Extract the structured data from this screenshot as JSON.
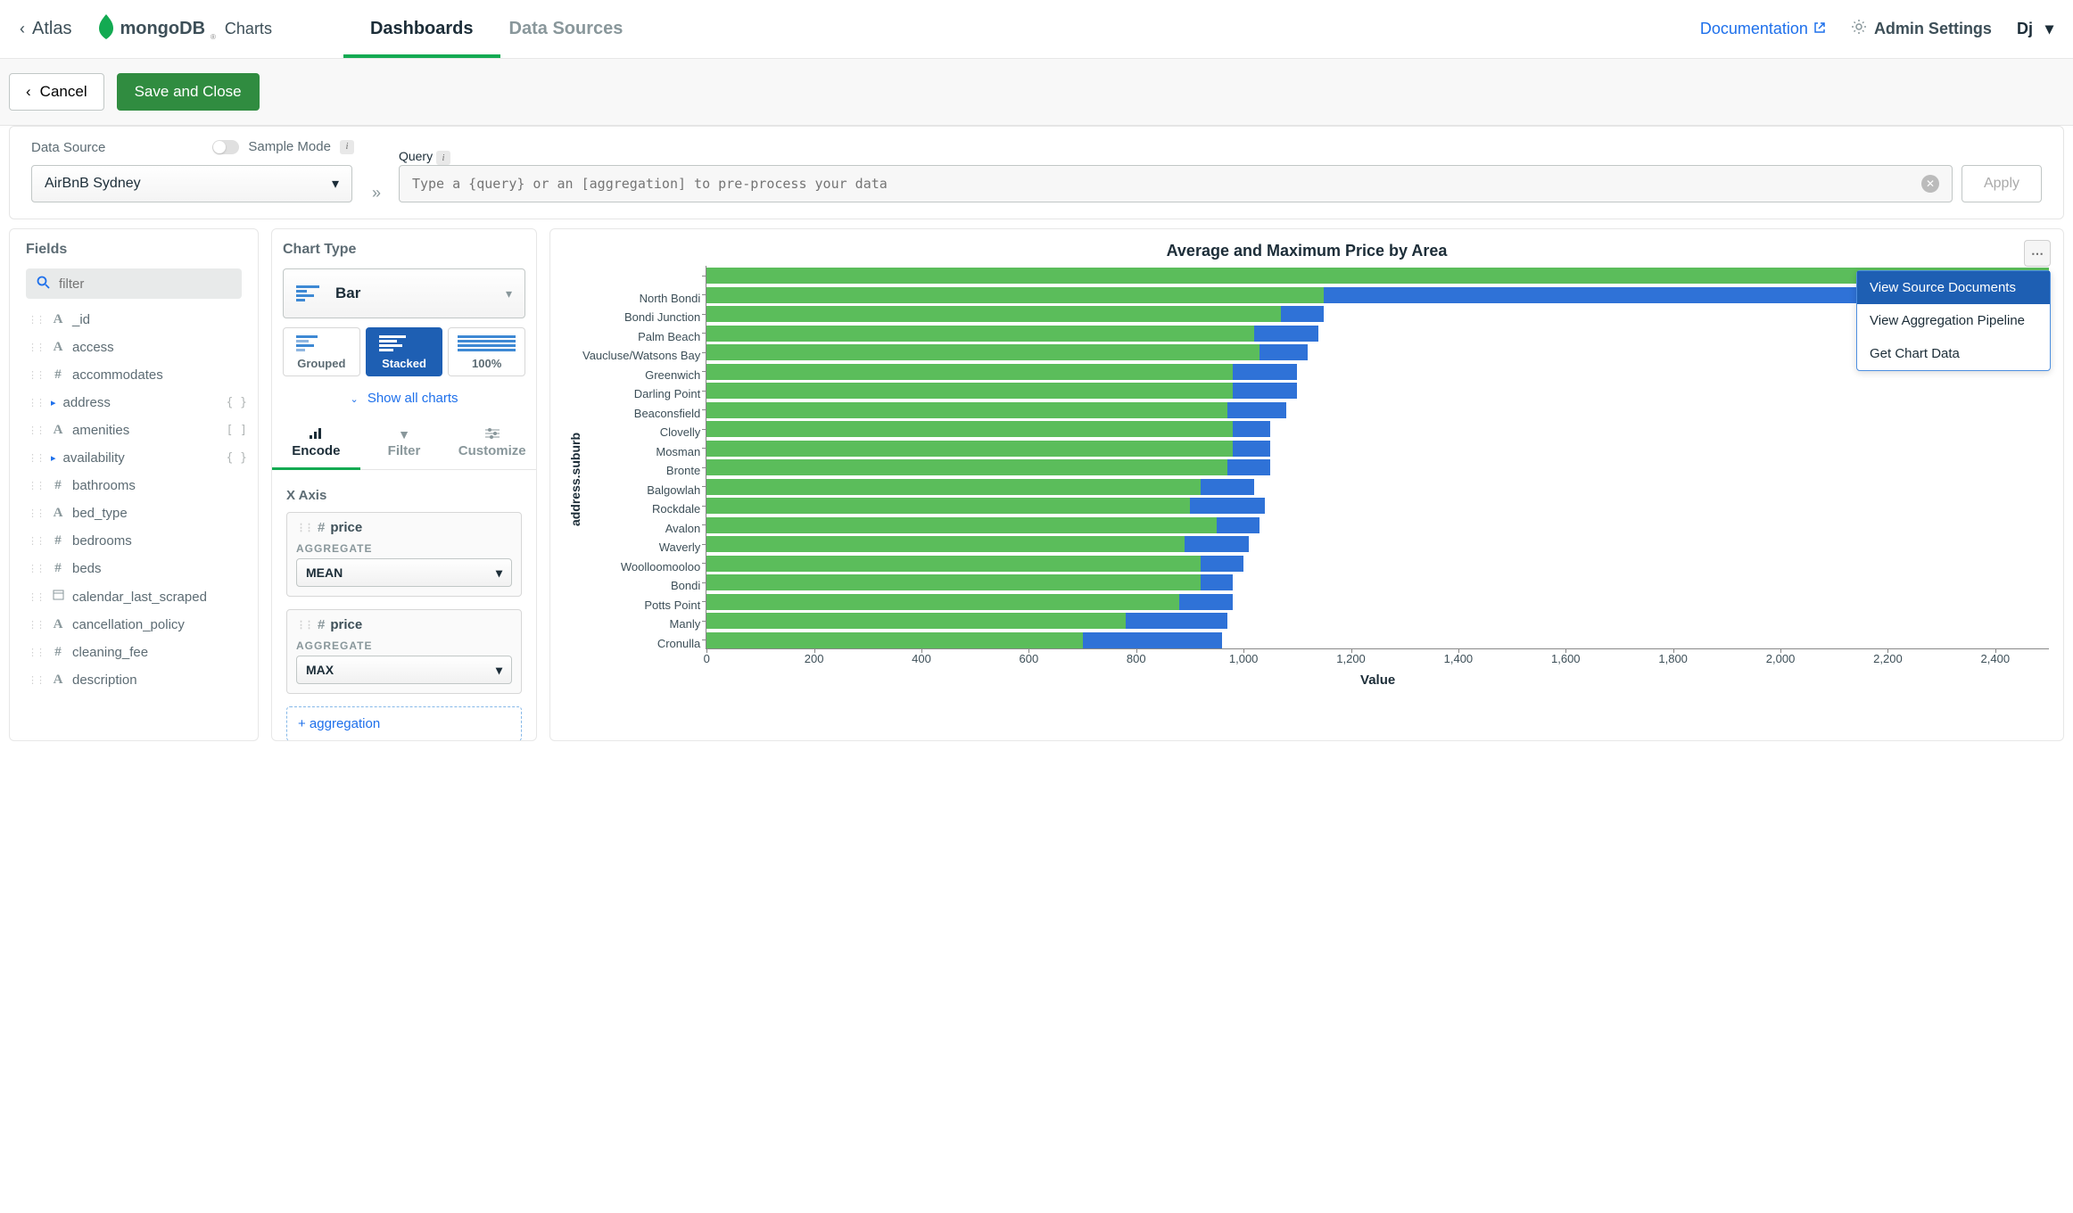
{
  "nav": {
    "atlas": "Atlas",
    "brand": "mongoDB",
    "brand_sub": "Charts",
    "tabs": {
      "dashboards": "Dashboards",
      "data_sources": "Data Sources"
    },
    "documentation": "Documentation",
    "admin": "Admin Settings",
    "user": "Dj"
  },
  "toolbar": {
    "cancel": "Cancel",
    "save": "Save and Close"
  },
  "ds": {
    "label": "Data Source",
    "value": "AirBnB Sydney",
    "sample": "Sample Mode",
    "query_label": "Query",
    "query_placeholder": "Type a {query} or an [aggregation] to pre-process your data",
    "apply": "Apply"
  },
  "fields": {
    "title": "Fields",
    "filter_placeholder": "filter",
    "items": [
      {
        "name": "_id",
        "type": "A"
      },
      {
        "name": "access",
        "type": "A"
      },
      {
        "name": "accommodates",
        "type": "#"
      },
      {
        "name": "address",
        "type": ">",
        "suffix": "{ }"
      },
      {
        "name": "amenities",
        "type": "A",
        "suffix": "[ ]"
      },
      {
        "name": "availability",
        "type": ">",
        "suffix": "{ }"
      },
      {
        "name": "bathrooms",
        "type": "#"
      },
      {
        "name": "bed_type",
        "type": "A"
      },
      {
        "name": "bedrooms",
        "type": "#"
      },
      {
        "name": "beds",
        "type": "#"
      },
      {
        "name": "calendar_last_scraped",
        "type": "cal"
      },
      {
        "name": "cancellation_policy",
        "type": "A"
      },
      {
        "name": "cleaning_fee",
        "type": "#"
      },
      {
        "name": "description",
        "type": "A"
      }
    ]
  },
  "config": {
    "chart_type_label": "Chart Type",
    "chart_type_value": "Bar",
    "subtypes": [
      "Grouped",
      "Stacked",
      "100%"
    ],
    "show_all": "Show all charts",
    "tabs": {
      "encode": "Encode",
      "filter": "Filter",
      "customize": "Customize"
    },
    "xaxis": "X Axis",
    "enc1": {
      "field": "price",
      "agg_label": "AGGREGATE",
      "agg": "MEAN"
    },
    "enc2": {
      "field": "price",
      "agg_label": "AGGREGATE",
      "agg": "MAX"
    },
    "add_agg": "+ aggregation"
  },
  "chart": {
    "title": "Average and Maximum Price by Area",
    "ylabel": "address.suburb",
    "xlabel": "Value",
    "menu": [
      "View Source Documents",
      "View Aggregation Pipeline",
      "Get Chart Data"
    ]
  },
  "chart_data": {
    "type": "bar",
    "orientation": "horizontal",
    "stacked": true,
    "ylabel_field": "address.suburb",
    "xlabel": "Value",
    "xlim": [
      0,
      2500
    ],
    "xticks": [
      0,
      200,
      400,
      600,
      800,
      1000,
      1200,
      1400,
      1600,
      1800,
      2000,
      2200,
      2400
    ],
    "series_names": [
      "mean(price)",
      "max(price)"
    ],
    "categories": [
      "",
      "North Bondi",
      "Bondi Junction",
      "Palm Beach",
      "Vaucluse/Watsons Bay",
      "Greenwich",
      "Darling Point",
      "Beaconsfield",
      "Clovelly",
      "Mosman",
      "Bronte",
      "Balgowlah",
      "Rockdale",
      "Avalon",
      "Waverly",
      "Woolloomooloo",
      "Bondi",
      "Potts Point",
      "Manly",
      "Cronulla"
    ],
    "series": [
      {
        "name": "mean(price)",
        "values": [
          2500,
          1150,
          1070,
          1020,
          1030,
          980,
          980,
          970,
          980,
          980,
          970,
          920,
          900,
          950,
          890,
          920,
          920,
          880,
          780,
          700
        ]
      },
      {
        "name": "max(price)",
        "values": [
          0,
          1010,
          80,
          120,
          90,
          120,
          120,
          110,
          70,
          70,
          80,
          100,
          140,
          80,
          120,
          80,
          60,
          100,
          190,
          260
        ]
      }
    ]
  }
}
